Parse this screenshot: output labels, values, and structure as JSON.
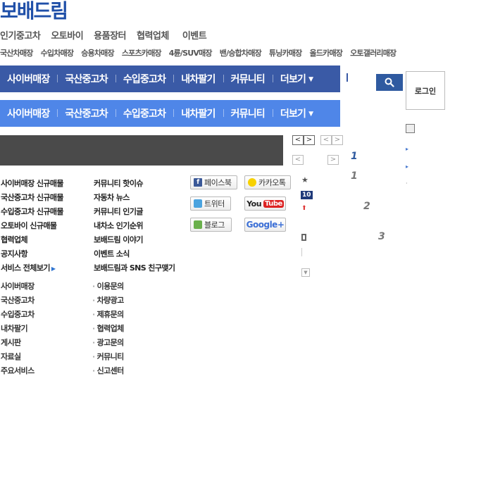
{
  "brand": {
    "logo": "보배드림"
  },
  "top_nav": [
    "인기중고차",
    "오토바이",
    "용품장터",
    "협력업체",
    "이벤트"
  ],
  "sub_nav": [
    "국산차매장",
    "수입차매장",
    "승용차매장",
    "스포츠카매장",
    "4륜/SUV매장",
    "밴/승합차매장",
    "튜닝카매장",
    "올드카매장",
    "오토갤러리매장"
  ],
  "main_menu": {
    "items": [
      "사이버매장",
      "국산중고차",
      "수입중고차",
      "내차팔기",
      "커뮤니티",
      "더보기"
    ]
  },
  "main_menu_2": {
    "items": [
      "사이버매장",
      "국산중고차",
      "수입중고차",
      "내차팔기",
      "커뮤니티",
      "더보기"
    ]
  },
  "search": {
    "icon": "search-icon"
  },
  "login": {
    "label": "로그인"
  },
  "ranking": {
    "numbers": [
      "1",
      "1",
      "2",
      "3"
    ],
    "badge": "10"
  },
  "quick_links": {
    "col1": [
      "사이버매장 신규매물",
      "국산중고차 신규매물",
      "수입중고차 신규매물",
      "오토바이 신규매물",
      "협력업체",
      "공지사항",
      "서비스 전체보기"
    ],
    "col2": [
      "커뮤니티 핫이슈",
      "자동차 뉴스",
      "커뮤니티 인기글",
      "내차소 인기순위",
      "보배드림 이야기",
      "이벤트 소식",
      "보배드림과 SNS 친구맺기"
    ]
  },
  "sns": {
    "facebook": "페이스북",
    "kakao": "카카오톡",
    "twitter": "트위터",
    "youtube_you": "You",
    "youtube_tube": "Tube",
    "blog": "블로그",
    "google": "Google+"
  },
  "footer_links": {
    "col1": [
      "사이버매장",
      "국산중고차",
      "수입중고차",
      "내차팔기",
      "게시판",
      "자료실",
      "주요서비스"
    ],
    "col2": [
      "이용문의",
      "차량광고",
      "제휴문의",
      "협력업체",
      "광고문의",
      "커뮤니티",
      "신고센터"
    ]
  },
  "colors": {
    "brand": "#1f4fa8",
    "menu_dark": "#3a5aa6",
    "menu_light": "#4f86e8",
    "banner": "#4a4a4a"
  }
}
